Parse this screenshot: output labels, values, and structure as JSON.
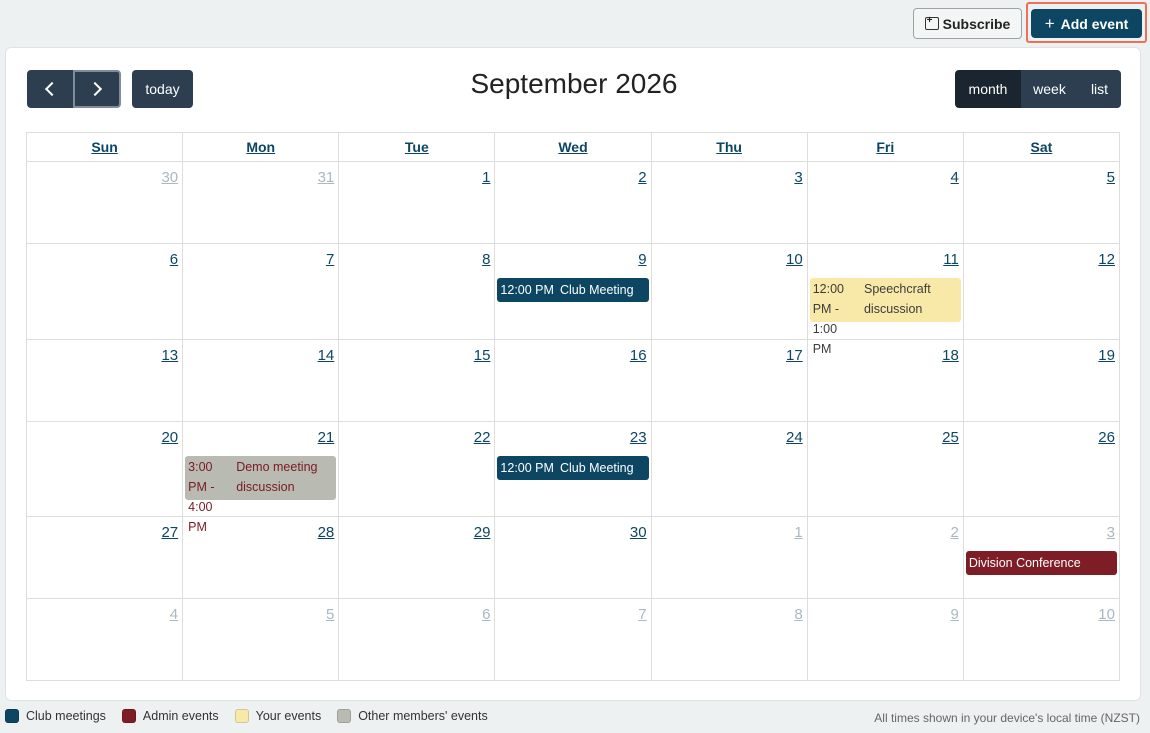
{
  "toolbar": {
    "subscribe_label": "Subscribe",
    "add_event_label": "Add event"
  },
  "calendar": {
    "title": "September 2026",
    "today_label": "today",
    "views": [
      "month",
      "week",
      "list"
    ],
    "active_view": "month",
    "weekdays": [
      "Sun",
      "Mon",
      "Tue",
      "Wed",
      "Thu",
      "Fri",
      "Sat"
    ],
    "weeks": [
      [
        "30",
        "31",
        "1",
        "2",
        "3",
        "4",
        "5"
      ],
      [
        "6",
        "7",
        "8",
        "9",
        "10",
        "11",
        "12"
      ],
      [
        "13",
        "14",
        "15",
        "16",
        "17",
        "18",
        "19"
      ],
      [
        "20",
        "21",
        "22",
        "23",
        "24",
        "25",
        "26"
      ],
      [
        "27",
        "28",
        "29",
        "30",
        "1",
        "2",
        "3"
      ],
      [
        "4",
        "5",
        "6",
        "7",
        "8",
        "9",
        "10"
      ]
    ],
    "events": {
      "club1": {
        "time": "12:00 PM",
        "title": "Club Meeting"
      },
      "speech": {
        "time": "12:00 PM - 1:00 PM",
        "title": "Speechcraft discussion"
      },
      "demo": {
        "time": "3:00 PM - 4:00 PM",
        "title": "Demo meeting discussion"
      },
      "club2": {
        "time": "12:00 PM",
        "title": "Club Meeting"
      },
      "division": {
        "title": "Division Conference"
      }
    }
  },
  "legend": {
    "club": "Club meetings",
    "admin": "Admin events",
    "yours": "Your events",
    "others": "Other members' events"
  },
  "colors": {
    "club": "#0c4663",
    "admin": "#7f1d26",
    "yours": "#f8e9a8",
    "others": "#b9bbb3",
    "accent_outline": "#ee7058"
  },
  "timezone_note": "All times shown in your device's local time (NZST)"
}
